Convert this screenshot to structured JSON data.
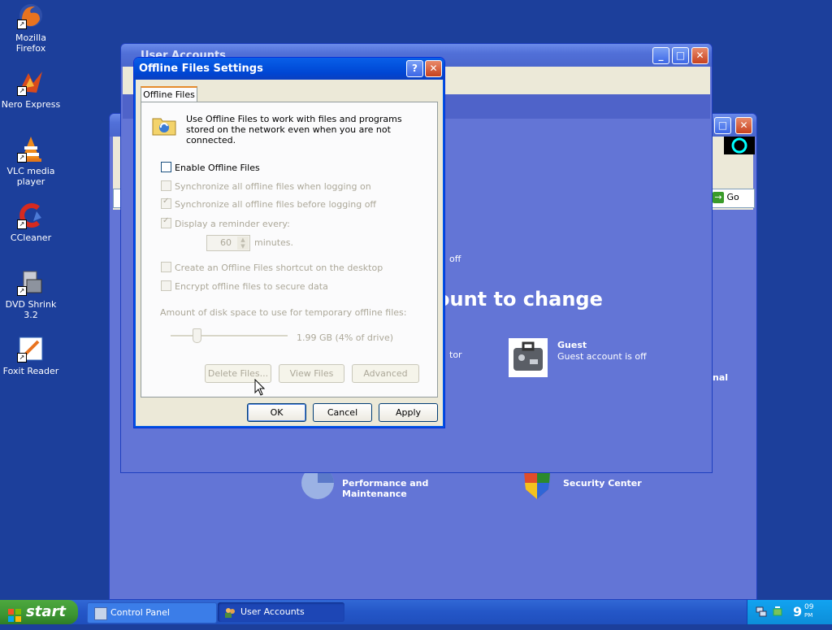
{
  "desktop": {
    "icons": [
      {
        "label": "Mozilla Firefox"
      },
      {
        "label": "Nero Express"
      },
      {
        "label": "VLC media player"
      },
      {
        "label": "CCleaner"
      },
      {
        "label": "DVD Shrink 3.2"
      },
      {
        "label": "Foxit Reader"
      }
    ]
  },
  "user_accounts_window": {
    "title": "User Accounts",
    "behind_text": {
      "off": "off",
      "heading_fragment": "ount to change",
      "tor": "tor",
      "guest_name": "Guest",
      "guest_status": "Guest account is off",
      "nal": "nal"
    }
  },
  "control_panel_window": {
    "go_label": "Go",
    "perf_label": "Performance and Maintenance",
    "security_label": "Security Center"
  },
  "dialog": {
    "title": "Offline Files Settings",
    "tab_label": "Offline Files",
    "intro": "Use Offline Files to work with files and programs stored on the network even when you are not connected.",
    "enable_label": "Enable Offline Files",
    "sync_logon_label": "Synchronize all offline files when logging on",
    "sync_logoff_label": "Synchronize all offline files before logging off",
    "reminder_label": "Display a reminder every:",
    "reminder_value": "60",
    "minutes_label": "minutes.",
    "shortcut_label": "Create an Offline Files shortcut on the desktop",
    "encrypt_label": "Encrypt offline files to secure data",
    "disk_space_label": "Amount of disk space to use for temporary offline files:",
    "disk_space_value": "1.99 GB (4% of drive)",
    "slider_fraction": 0.04,
    "delete_files_label": "Delete Files...",
    "view_files_label": "View Files",
    "advanced_label": "Advanced",
    "ok_label": "OK",
    "cancel_label": "Cancel",
    "apply_label": "Apply",
    "checkbox_states": {
      "enable": false,
      "sync_logon": false,
      "sync_logoff": true,
      "reminder": true,
      "shortcut": false,
      "encrypt": false
    }
  },
  "taskbar": {
    "start_label": "start",
    "items": [
      {
        "label": "Control Panel"
      },
      {
        "label": "User Accounts"
      }
    ],
    "clock_hour": "9",
    "clock_minutes": "09",
    "clock_ampm": "PM"
  },
  "colors": {
    "desktop": "#1c3f9b",
    "cp_blue": "#6375d6",
    "xp_title": "#0058e6",
    "start_green": "#3c9533"
  }
}
